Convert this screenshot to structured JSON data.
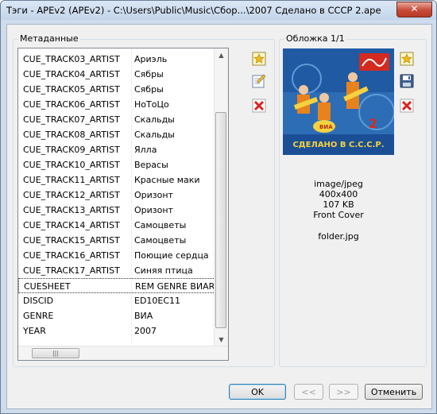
{
  "window": {
    "title": "Тэги - APEv2 (APEv2) - C:\\Users\\Public\\Music\\Сбор...\\2007 Сделано в СССР 2.ape",
    "close_label": "✕"
  },
  "metadata": {
    "group_label": "Метаданные",
    "rows": [
      {
        "key": "CUE_TRACK03_ARTIST",
        "value": "Ариэль"
      },
      {
        "key": "CUE_TRACK04_ARTIST",
        "value": "Сябры"
      },
      {
        "key": "CUE_TRACK05_ARTIST",
        "value": "Сябры"
      },
      {
        "key": "CUE_TRACK06_ARTIST",
        "value": "НоТоЦо"
      },
      {
        "key": "CUE_TRACK07_ARTIST",
        "value": "Скальды"
      },
      {
        "key": "CUE_TRACK08_ARTIST",
        "value": "Скальды"
      },
      {
        "key": "CUE_TRACK09_ARTIST",
        "value": "Ялла"
      },
      {
        "key": "CUE_TRACK10_ARTIST",
        "value": "Верасы"
      },
      {
        "key": "CUE_TRACK11_ARTIST",
        "value": "Красные маки"
      },
      {
        "key": "CUE_TRACK12_ARTIST",
        "value": "Оризонт"
      },
      {
        "key": "CUE_TRACK13_ARTIST",
        "value": "Оризонт"
      },
      {
        "key": "CUE_TRACK14_ARTIST",
        "value": "Самоцветы"
      },
      {
        "key": "CUE_TRACK15_ARTIST",
        "value": "Самоцветы"
      },
      {
        "key": "CUE_TRACK16_ARTIST",
        "value": "Поющие сердца"
      },
      {
        "key": "CUE_TRACK17_ARTIST",
        "value": "Синяя птица"
      },
      {
        "key": "CUESHEET",
        "value": "REM GENRE ВИАREM"
      },
      {
        "key": "DISCID",
        "value": "ED10EC11"
      },
      {
        "key": "GENRE",
        "value": "ВИА"
      },
      {
        "key": "YEAR",
        "value": "2007"
      }
    ],
    "selected_index": 15,
    "hscroll_grip": "|||"
  },
  "cover": {
    "group_label": "Обложка 1/1",
    "art_text": "СДЕЛАНО В С.С.С.Р.",
    "art_number": "2",
    "mime": "image/jpeg",
    "dimensions": "400x400",
    "size": "107 KB",
    "type": "Front Cover",
    "filename": "folder.jpg"
  },
  "icons": {
    "add": "add-tag-icon",
    "edit": "edit-tag-icon",
    "delete": "delete-icon",
    "save": "save-icon"
  },
  "buttons": {
    "ok": "OK",
    "prev": "<<",
    "next": ">>",
    "cancel": "Отменить"
  }
}
